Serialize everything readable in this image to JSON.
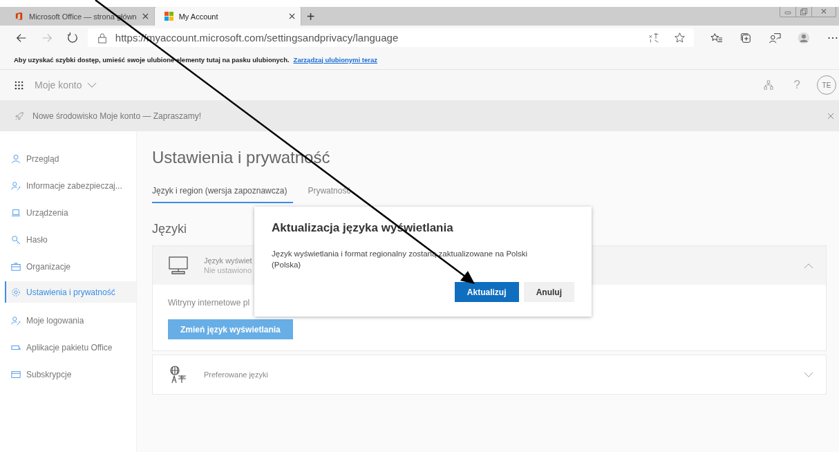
{
  "browser": {
    "tabs": [
      {
        "title": "Microsoft Office — strona główn",
        "selected": false
      },
      {
        "title": "My Account",
        "selected": true
      }
    ],
    "new_tab": "+",
    "url": "https://myaccount.microsoft.com/settingsandprivacy/language",
    "favorites_bar": {
      "text": "Aby uzyskać szybki dostęp, umieść swoje ulubione elementy tutaj na pasku ulubionych.",
      "link": "Zarządzaj ulubionymi teraz"
    }
  },
  "app_header": {
    "app_name": "Moje konto",
    "help": "?",
    "avatar": "TE"
  },
  "banner": {
    "text": "Nowe środowisko Moje konto — Zapraszamy!"
  },
  "sidebar": {
    "items": [
      {
        "label": "Przegląd",
        "selected": false
      },
      {
        "label": "Informacje zabezpieczaj...",
        "selected": false
      },
      {
        "label": "Urządzenia",
        "selected": false
      },
      {
        "label": "Hasło",
        "selected": false
      },
      {
        "label": "Organizacje",
        "selected": false
      },
      {
        "label": "Ustawienia i prywatność",
        "selected": true
      },
      {
        "label": "Moje logowania",
        "selected": false
      },
      {
        "label": "Aplikacje pakietu Office",
        "selected": false
      },
      {
        "label": "Subskrypcje",
        "selected": false
      }
    ]
  },
  "page": {
    "title": "Ustawienia i prywatność",
    "tabs": [
      {
        "label": "Język i region (wersja zapoznawcza)",
        "selected": true
      },
      {
        "label": "Prywatność",
        "selected": false
      }
    ],
    "section_title": "Języki",
    "cards": [
      {
        "title": "Język wyświet",
        "subtitle": "Nie ustawiono",
        "expanded": true,
        "body_text": "Witryny internetowe pl",
        "button": "Zmień język wyświetlania"
      },
      {
        "title": "Preferowane języki",
        "expanded": false
      }
    ]
  },
  "dialog": {
    "title": "Aktualizacja języka wyświetlania",
    "message": "Język wyświetlania i format regionalny zostaną zaktualizowane na Polski (Polska)",
    "buttons": [
      {
        "label": "Aktualizuj",
        "kind": "primary"
      },
      {
        "label": "Anuluj",
        "kind": "secondary"
      }
    ]
  }
}
